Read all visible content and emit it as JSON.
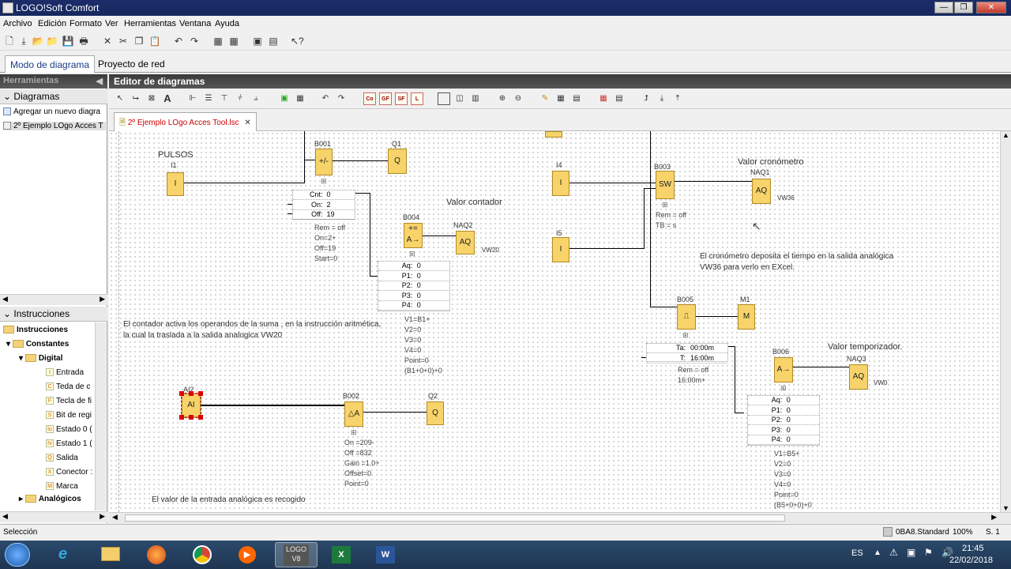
{
  "window": {
    "title": "LOGO!Soft Comfort"
  },
  "menu": [
    "Archivo",
    "Edición",
    "Formato",
    "Ver",
    "Herramientas",
    "Ventana",
    "Ayuda"
  ],
  "mode_tabs": {
    "diagram": "Modo de diagrama",
    "network": "Proyecto de red"
  },
  "left_panel": {
    "tools_title": "Herramientas",
    "diagrams_title": "Diagramas",
    "diagram_items": [
      "Agregar un nuevo diagra",
      "2º Ejemplo LOgo Acces T"
    ],
    "instructions_title": "Instrucciones",
    "tree": {
      "root": "Instrucciones",
      "constants": "Constantes",
      "digital": "Digital",
      "items": [
        {
          "icon": "I",
          "label": "Entrada"
        },
        {
          "icon": "C",
          "label": "Teda de c"
        },
        {
          "icon": "F",
          "label": "Tecla de fi"
        },
        {
          "icon": "S",
          "label": "Bit de regi"
        },
        {
          "icon": "lo",
          "label": "Estado 0 ("
        },
        {
          "icon": "hi",
          "label": "Estado 1 ("
        },
        {
          "icon": "Q",
          "label": "Salida"
        },
        {
          "icon": "X",
          "label": "Conector :"
        },
        {
          "icon": "M",
          "label": "Marca"
        }
      ],
      "analog": "Analógicos"
    }
  },
  "editor": {
    "title": "Editor de diagramas",
    "doc_tab": "2º Ejemplo LOgo Acces Tool.lsc",
    "tool_boxes": [
      "Co",
      "GF",
      "SF",
      "L"
    ]
  },
  "diagram": {
    "pulsos": "PULSOS",
    "i1": "I1",
    "i1_sym": "I",
    "b001": "B001",
    "b001_sym": "+/-",
    "q1": "Q1",
    "q1_sym": "Q",
    "b001_params": [
      {
        "k": "Cnt",
        "v": "0"
      },
      {
        "k": "On",
        "v": "2"
      },
      {
        "k": "Off",
        "v": "19"
      }
    ],
    "b001_info": [
      "Rem = off",
      "On=2+",
      "Off=19",
      "Start=0"
    ],
    "valor_contador": "Valor contador",
    "b004": "B004",
    "b004_sym": "+=\nA→",
    "naq2": "NAQ2",
    "naq2_sym": "AQ",
    "vw20": "VW20",
    "b004_params": [
      {
        "k": "Aq",
        "v": "0"
      },
      {
        "k": "P1",
        "v": "0"
      },
      {
        "k": "P2",
        "v": "0"
      },
      {
        "k": "P3",
        "v": "0"
      },
      {
        "k": "P4",
        "v": "0"
      }
    ],
    "b004_info": [
      "V1=B1+",
      "V2=0",
      "V3=0",
      "V4=0",
      "Point=0",
      "(B1+0+0)+0"
    ],
    "note_contador": "El contador activa los operandos de la suma , en la instrucción aritmética, la cual la traslada a la salida analogica VW20",
    "i4": "I4",
    "i5": "I5",
    "i_sym": "I",
    "b003": "B003",
    "b003_sym": "SW",
    "b003_info": [
      "Rem = off",
      "TB = s"
    ],
    "valor_cronometro": "Valor cronómetro",
    "naq1": "NAQ1",
    "naq1_sym": "AQ",
    "vw36": "VW36",
    "note_cronometro": "El cronómetro deposita el tiempo en la salida analógica VW36 para verlo en EXcel.",
    "b005": "B005",
    "m1": "M1",
    "m1_sym": "M",
    "b005_params": [
      {
        "k": "Ta",
        "v": "00:00m"
      },
      {
        "k": "T",
        "v": "16:00m"
      }
    ],
    "b005_info": [
      "Rem = off",
      "16:00m+"
    ],
    "b006": "B006",
    "b006_sym": "A→",
    "valor_temporizador": "Valor temporizador.",
    "naq3": "NAQ3",
    "naq3_sym": "AQ",
    "vw0": "VW0",
    "b006_params": [
      {
        "k": "Aq",
        "v": "0"
      },
      {
        "k": "P1",
        "v": "0"
      },
      {
        "k": "P2",
        "v": "0"
      },
      {
        "k": "P3",
        "v": "0"
      },
      {
        "k": "P4",
        "v": "0"
      }
    ],
    "b006_info": [
      "V1=B5+",
      "V2=0",
      "V3=0",
      "V4=0",
      "Point=0",
      "(B5+0+0)+0"
    ],
    "ai2": "AI2",
    "ai2_sym": "AI",
    "b002": "B002",
    "b002_sym": "△A",
    "q2": "Q2",
    "q2_sym": "Q",
    "b002_info": [
      "On   =209-",
      "Off  =832",
      "Gain  =1.0+",
      "Offset=0",
      "Point=0"
    ],
    "note_analog": "El valor de la entrada analógica es recogido"
  },
  "status": {
    "left": "Selección",
    "device": "0BA8.Standard",
    "zoom": "100%",
    "page": "S. 1"
  },
  "taskbar": {
    "lang": "ES",
    "time": "21:45",
    "date": "22/02/2018",
    "logo_label": "LOGO\nV8"
  }
}
